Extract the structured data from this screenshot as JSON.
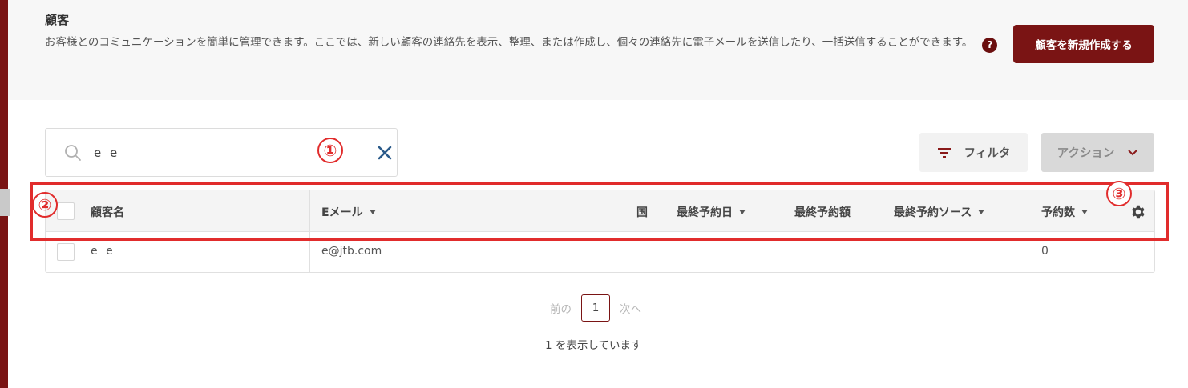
{
  "header": {
    "title": "顧客",
    "description": "お客様とのコミュニケーションを簡単に管理できます。ここでは、新しい顧客の連絡先を表示、整理、または作成し、個々の連絡先に電子メールを送信したり、一括送信することができます。",
    "help_icon": "?",
    "create_button": "顧客を新規作成する"
  },
  "search": {
    "value": "e e",
    "icon": "search-icon",
    "clear_icon": "close-icon"
  },
  "toolbar": {
    "filter_label": "フィルタ",
    "action_label": "アクション"
  },
  "annotations": [
    "①",
    "②",
    "③"
  ],
  "table": {
    "columns": [
      "顧客名",
      "Eメール",
      "国",
      "最終予約日",
      "最終予約額",
      "最終予約ソース",
      "予約数"
    ],
    "rows": [
      {
        "name": "e e",
        "email": "e@jtb.com",
        "country": "",
        "last_date": "",
        "last_amount": "",
        "last_source": "",
        "count": "0"
      }
    ]
  },
  "pagination": {
    "prev": "前の",
    "current": "1",
    "next": "次へ",
    "showing": "1 を表示しています"
  },
  "colors": {
    "brand": "#7a1414",
    "annotation": "#e12c2c"
  }
}
